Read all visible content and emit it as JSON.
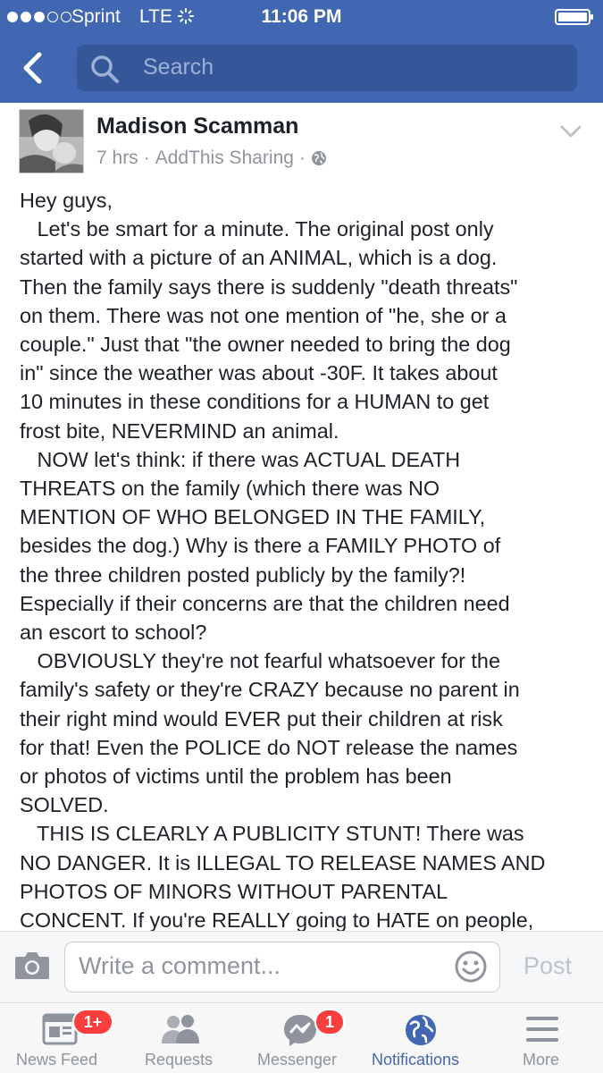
{
  "status_bar": {
    "carrier": "Sprint",
    "network": "LTE",
    "time": "11:06 PM",
    "signal_bars_filled": 3,
    "signal_bars_total": 5
  },
  "search": {
    "placeholder": "Search"
  },
  "post": {
    "author": "Madison Scamman",
    "time_ago": "7 hrs",
    "separator": "·",
    "source": "AddThis Sharing",
    "privacy_icon": "globe-icon",
    "lines": [
      "Hey guys,",
      "   Let's be smart for a minute. The original post only",
      "started with a picture of an ANIMAL, which is a dog.",
      "Then the family says there is suddenly \"death threats\"",
      "on them. There was not one mention of \"he, she or a",
      "couple.\" Just that \"the owner needed to bring the dog",
      "in\" since the weather was about -30F. It takes about",
      "10 minutes in these conditions for a HUMAN to get",
      "frost bite, NEVERMIND an animal.",
      "   NOW let's think: if there was ACTUAL DEATH",
      "THREATS on the family (which there was NO",
      "MENTION OF WHO BELONGED IN THE FAMILY,",
      "besides the dog.) Why is there a FAMILY PHOTO of",
      "the three children posted publicly by the family?!",
      "Especially if their concerns are that the children need",
      "an escort to school?",
      "   OBVIOUSLY they're not fearful whatsoever for the",
      "family's safety or they're CRAZY because no parent in",
      "their right mind would EVER put their children at risk",
      "for that! Even the POLICE do NOT release the names",
      "or photos of victims until the problem has been",
      "SOLVED.",
      "   THIS IS CLEARLY A PUBLICITY STUNT! There was",
      "NO DANGER. It is ILLEGAL TO RELEASE NAMES AND",
      "PHOTOS OF MINORS WITHOUT PARENTAL",
      "CONCENT. If you're REALLY going to HATE on people,"
    ]
  },
  "comment_bar": {
    "placeholder": "Write a comment...",
    "post_label": "Post"
  },
  "tabs": [
    {
      "label": "News Feed",
      "icon": "news-feed-icon",
      "badge": "1+",
      "active": false
    },
    {
      "label": "Requests",
      "icon": "friend-requests-icon",
      "badge": "",
      "active": false
    },
    {
      "label": "Messenger",
      "icon": "messenger-icon",
      "badge": "1",
      "active": false
    },
    {
      "label": "Notifications",
      "icon": "globe-icon",
      "badge": "",
      "active": true
    },
    {
      "label": "More",
      "icon": "menu-icon",
      "badge": "",
      "active": false
    }
  ],
  "colors": {
    "brand_blue": "#4267b2",
    "badge_red": "#fa3e3e",
    "inactive_gray": "#8d949e"
  }
}
